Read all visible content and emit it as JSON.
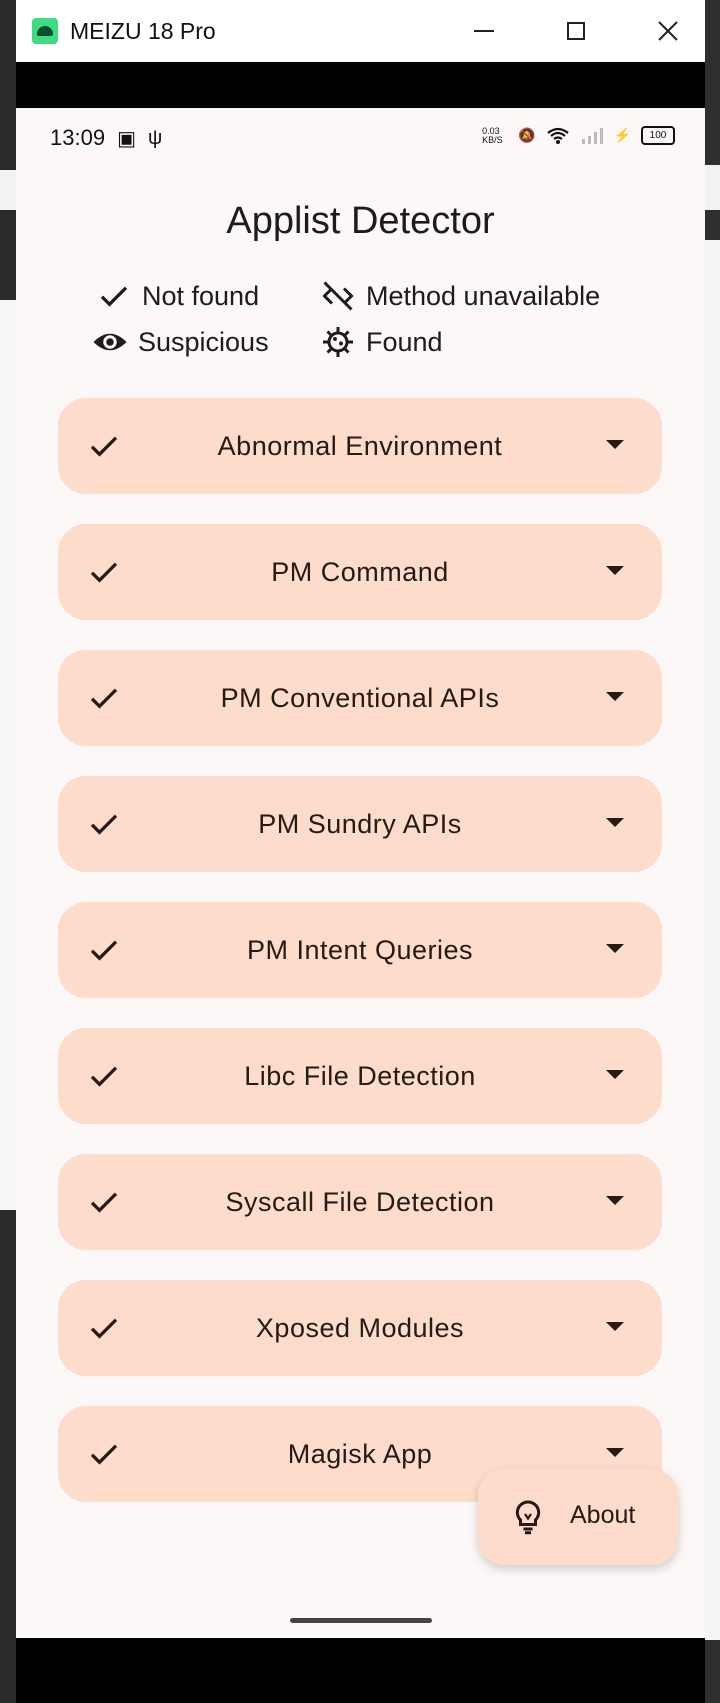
{
  "window": {
    "title": "MEIZU 18 Pro",
    "minimize_icon": "minimize-icon",
    "maximize_icon": "maximize-icon",
    "close_icon": "close-icon"
  },
  "statusbar": {
    "time": "13:09",
    "net_speed": "0.03 KB/S",
    "battery": "100"
  },
  "app": {
    "title": "Applist Detector"
  },
  "legend": {
    "not_found": "Not found",
    "method_unavailable": "Method unavailable",
    "suspicious": "Suspicious",
    "found": "Found"
  },
  "detections": [
    {
      "label": "Abnormal Environment",
      "status": "not_found"
    },
    {
      "label": "PM Command",
      "status": "not_found"
    },
    {
      "label": "PM Conventional APIs",
      "status": "not_found"
    },
    {
      "label": "PM Sundry APIs",
      "status": "not_found"
    },
    {
      "label": "PM Intent Queries",
      "status": "not_found"
    },
    {
      "label": "Libc File Detection",
      "status": "not_found"
    },
    {
      "label": "Syscall File Detection",
      "status": "not_found"
    },
    {
      "label": "Xposed Modules",
      "status": "not_found"
    },
    {
      "label": "Magisk App",
      "status": "not_found"
    }
  ],
  "fab": {
    "label": "About",
    "icon": "lightbulb-icon"
  },
  "colors": {
    "card_bg": "#fddccb",
    "page_bg": "#fdf8f8",
    "text": "#251a15"
  }
}
